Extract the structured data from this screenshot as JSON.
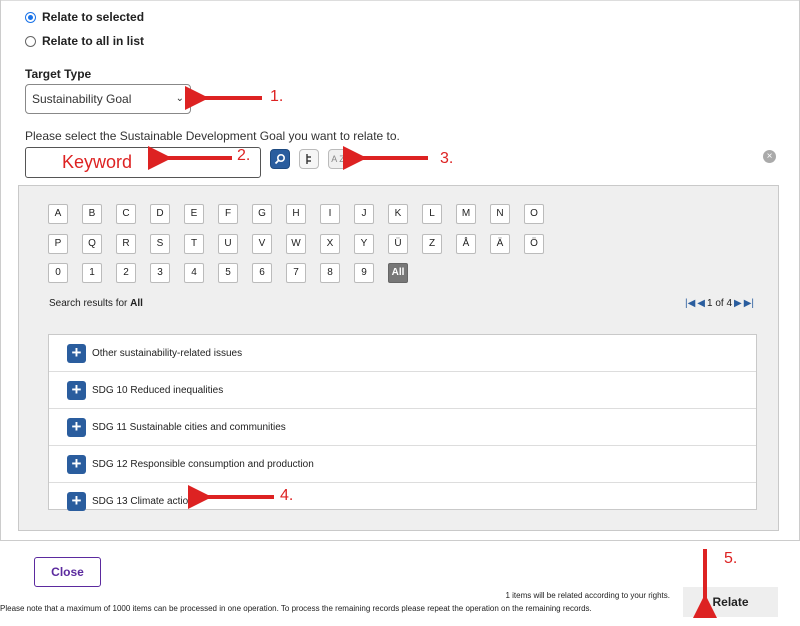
{
  "relate_options": {
    "selected_label": "Relate to selected",
    "all_label": "Relate to all in list"
  },
  "target_type": {
    "label": "Target Type",
    "value": "Sustainability Goal"
  },
  "prompt": "Please select the Sustainable Development Goal you want to relate to.",
  "keyword": {
    "placeholder": "Keyword"
  },
  "az_icon_text": "A Z",
  "clear_icon_glyph": "×",
  "alphabet": {
    "row1": [
      "A",
      "B",
      "C",
      "D",
      "E",
      "F",
      "G",
      "H",
      "I",
      "J",
      "K",
      "L",
      "M",
      "N",
      "O"
    ],
    "row2": [
      "P",
      "Q",
      "R",
      "S",
      "T",
      "U",
      "V",
      "W",
      "X",
      "Y",
      "Ü",
      "Z",
      "Å",
      "Ä",
      "Ö"
    ],
    "row3": [
      "0",
      "1",
      "2",
      "3",
      "4",
      "5",
      "6",
      "7",
      "8",
      "9",
      "All"
    ],
    "active": "All"
  },
  "results": {
    "prefix": "Search results for ",
    "term": "All",
    "pager": "1 of 4"
  },
  "items": [
    "Other sustainability-related issues",
    "SDG 10 Reduced inequalities",
    "SDG 11 Sustainable cities and communities",
    "SDG 12 Responsible consumption and production",
    "SDG 13 Climate action"
  ],
  "footer": {
    "close_label": "Close",
    "relate_label": "Relate",
    "note_rights": "1 items will be related according to your rights.",
    "note_limit": "Please note that a maximum of 1000 items can be processed in one operation. To process the remaining records please repeat the operation on the remaining records."
  },
  "annotations": [
    "1.",
    "2.",
    "3.",
    "4.",
    "5."
  ],
  "annotation_color": "#dd2222",
  "accent_color": "#2a5d9e"
}
